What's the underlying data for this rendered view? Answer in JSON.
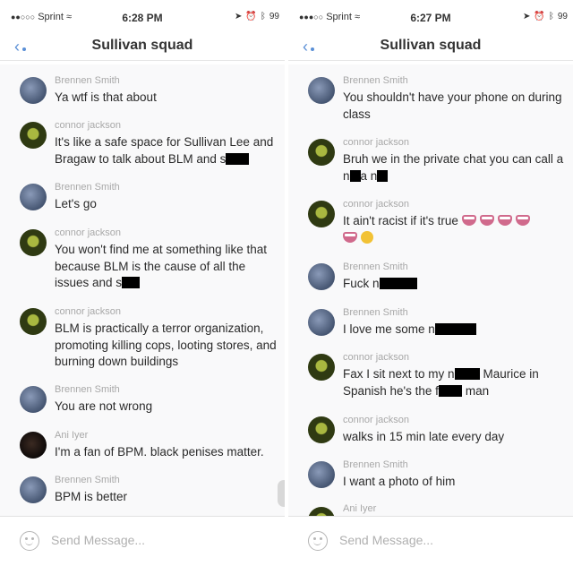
{
  "left": {
    "status": {
      "carrier": "Sprint",
      "time": "6:28 PM",
      "battery": "99"
    },
    "nav": {
      "back_icon": "chevron-left-icon",
      "title": "Sullivan squad"
    },
    "messages": [
      {
        "sender": "Brennen Smith",
        "text": "Ya wtf is that about"
      },
      {
        "sender": "connor jackson",
        "text_a": "It's like a safe space for Sullivan Lee and Bragaw to talk about BLM and s"
      },
      {
        "sender": "Brennen Smith",
        "text": "Let's go"
      },
      {
        "sender": "connor jackson",
        "text_a": "You won't find me at something like that because BLM is the cause of all the issues and s"
      },
      {
        "sender": "connor jackson",
        "text": "BLM is practically a terror organization, promoting killing cops, looting stores, and burning down buildings"
      },
      {
        "sender": "Brennen Smith",
        "text": "You are not wrong"
      },
      {
        "sender": "Ani Iyer",
        "text": "I'm a fan of BPM. black penises matter."
      },
      {
        "sender": "Brennen Smith",
        "text": "BPM is better"
      }
    ],
    "composer": {
      "placeholder": "Send Message..."
    }
  },
  "right": {
    "status": {
      "carrier": "Sprint",
      "time": "6:27 PM",
      "battery": "99"
    },
    "nav": {
      "back_icon": "chevron-left-icon",
      "title": "Sullivan squad"
    },
    "messages": [
      {
        "sender": "Brennen Smith",
        "text": "You shouldn't have your phone on during class"
      },
      {
        "sender": "connor jackson",
        "text_a": "Bruh we in the private chat you can call a n",
        "text_b": "a n"
      },
      {
        "sender": "connor jackson",
        "text_a": "It ain't racist if it's true"
      },
      {
        "sender": "Brennen Smith",
        "text_a": "Fuck n"
      },
      {
        "sender": "Brennen Smith",
        "text_a": "I love me some n"
      },
      {
        "sender": "connor jackson",
        "text_a": "Fax I sit next to my n",
        "text_b": "Maurice in Spanish he's the f",
        "text_c": "man"
      },
      {
        "sender": "connor jackson",
        "text": "walks in 15 min late every day"
      },
      {
        "sender": "Brennen Smith",
        "text": "I want a photo of him"
      },
      {
        "sender": "Ani Iyer"
      }
    ],
    "composer": {
      "placeholder": "Send Message..."
    }
  }
}
